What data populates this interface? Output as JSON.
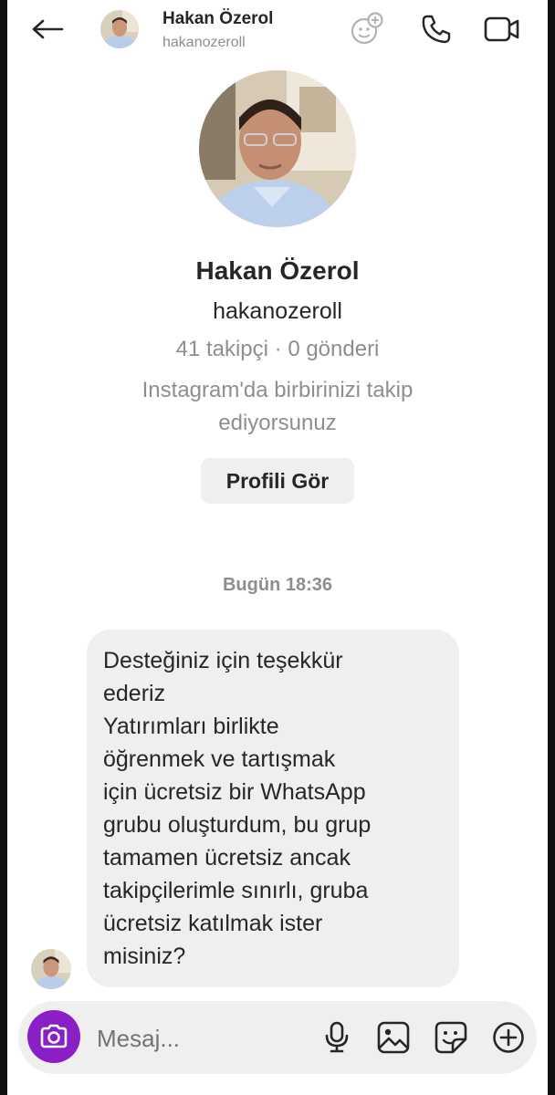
{
  "header": {
    "name": "Hakan Özerol",
    "username": "hakanozeroll",
    "icons": [
      "back-arrow-icon",
      "effects-icon",
      "phone-icon",
      "video-camera-icon"
    ]
  },
  "profile": {
    "name": "Hakan Özerol",
    "username": "hakanozeroll",
    "stats": "41 takipçi · 0 gönderi",
    "mutual": "Instagram'da birbirinizi takip ediyorsunuz",
    "view_profile_label": "Profili Gör"
  },
  "conversation": {
    "timestamp": "Bugün 18:36",
    "messages": [
      {
        "text": "Desteğiniz için teşekkür\nederiz\nYatırımları birlikte\nöğrenmek ve tartışmak\niçin ücretsiz bir WhatsApp\ngrubu oluşturdum, bu grup\ntamamen ücretsiz ancak\ntakipçilerimle sınırlı, gruba\nücretsiz katılmak ister\nmisiniz?"
      }
    ]
  },
  "composer": {
    "placeholder": "Mesaj...",
    "icons": [
      "camera-icon",
      "microphone-icon",
      "gallery-icon",
      "sticker-icon",
      "plus-icon"
    ]
  },
  "colors": {
    "camera_button": "#8b1fc7",
    "bubble": "#efefef",
    "secondary_text": "#8e8e8e"
  }
}
